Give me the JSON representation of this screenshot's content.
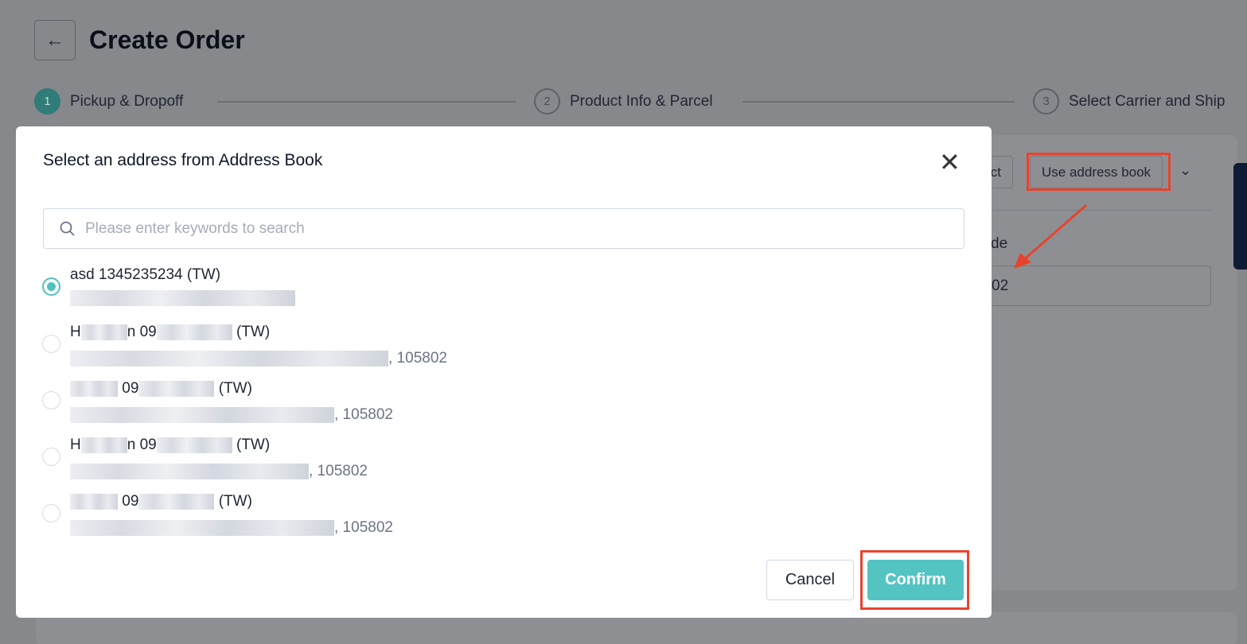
{
  "page": {
    "title": "Create Order",
    "back_icon": "arrow-left-icon"
  },
  "steps": [
    {
      "num": "1",
      "label": "Pickup & Dropoff",
      "active": true
    },
    {
      "num": "2",
      "label": "Product Info & Parcel",
      "active": false
    },
    {
      "num": "3",
      "label": "Select Carrier and Ship",
      "active": false
    }
  ],
  "background": {
    "partial_button": "ct",
    "address_book_button": "Use address book",
    "partial_label": "de",
    "partial_input": "02"
  },
  "modal": {
    "title": "Select an address from Address Book",
    "search_placeholder": "Please enter keywords to search",
    "addresses": [
      {
        "line1_a": "asd 1345235234",
        "line1_b": " (TW)",
        "line2_suffix": "",
        "selected": true
      },
      {
        "line1_a": "H",
        "line1_mid": "n 09",
        "line1_b": " (TW)",
        "line2_suffix": ", 105802",
        "selected": false
      },
      {
        "line1_a": "",
        "line1_mid": " 09",
        "line1_b": " (TW)",
        "line2_suffix": ", 105802",
        "selected": false
      },
      {
        "line1_a": "H",
        "line1_mid": "n 09",
        "line1_b": " (TW)",
        "line2_suffix": ", 105802",
        "selected": false
      },
      {
        "line1_a": "",
        "line1_mid": " 09",
        "line1_b": " (TW)",
        "line2_suffix": ", 105802",
        "selected": false
      }
    ],
    "cancel": "Cancel",
    "confirm": "Confirm"
  },
  "colors": {
    "accent": "#54c4c2",
    "highlight": "#e8432d",
    "overlay": "#87888c"
  }
}
